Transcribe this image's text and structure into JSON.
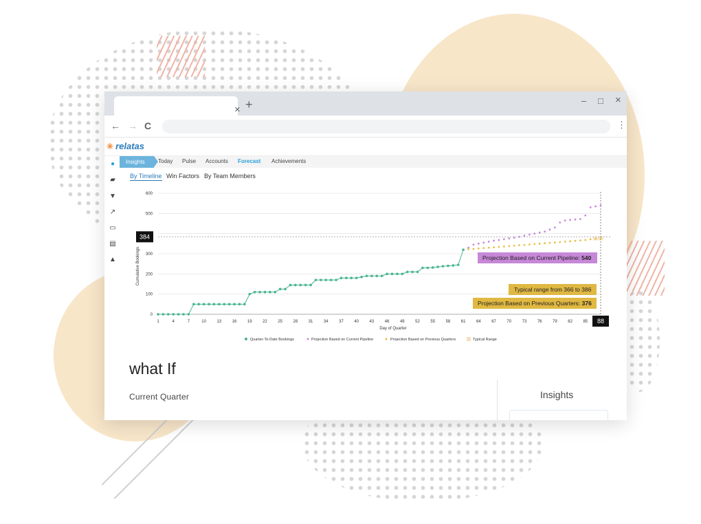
{
  "browser": {
    "tab_close": "×",
    "new_tab": "+",
    "minimize": "–",
    "maximize": "□",
    "close": "×",
    "back": "←",
    "forward": "→",
    "reload": "C",
    "menu": "⋮"
  },
  "app": {
    "logo_text": "relatas",
    "sidebar_icons": [
      "lightbulb-icon",
      "chat-icon",
      "funnel-icon",
      "trend-icon",
      "card-icon",
      "document-icon",
      "bell-icon"
    ],
    "nav": {
      "items": [
        "Insights",
        "Today",
        "Pulse",
        "Accounts",
        "Forecast",
        "Achievements"
      ],
      "active": "Insights",
      "highlight": "Forecast"
    },
    "subtabs": {
      "items": [
        "By Timeline",
        "Win Factors",
        "By Team Members"
      ],
      "active": "By Timeline"
    },
    "colors": {
      "accent": "#6cb4dd",
      "bookings": "#48b58e",
      "pipeline": "#c788d8",
      "previous": "#e9bf45",
      "typical": "#f5e0c0"
    }
  },
  "chart_data": {
    "type": "line",
    "xlabel": "Day of Quarter",
    "ylabel": "Cumulative Bookings",
    "xlim": [
      1,
      88
    ],
    "ylim": [
      0,
      600
    ],
    "x_ticks": [
      1,
      4,
      7,
      10,
      13,
      16,
      19,
      22,
      25,
      28,
      31,
      34,
      37,
      40,
      43,
      46,
      49,
      52,
      55,
      58,
      61,
      64,
      67,
      70,
      73,
      76,
      79,
      82,
      85
    ],
    "y_ticks": [
      0,
      100,
      200,
      300,
      400,
      500,
      600
    ],
    "cursor": {
      "x": 88,
      "y": 384,
      "x_label": "88",
      "y_label": "384"
    },
    "series": [
      {
        "name": "Quarter-To-Date Bookings",
        "style": "line-dots",
        "x": [
          1,
          2,
          3,
          4,
          5,
          6,
          7,
          8,
          9,
          10,
          11,
          12,
          13,
          14,
          15,
          16,
          17,
          18,
          19,
          20,
          21,
          22,
          23,
          24,
          25,
          26,
          27,
          28,
          29,
          30,
          31,
          32,
          33,
          34,
          35,
          36,
          37,
          38,
          39,
          40,
          41,
          42,
          43,
          44,
          45,
          46,
          47,
          48,
          49,
          50,
          51,
          52,
          53,
          54,
          55,
          56,
          57,
          58,
          59,
          60,
          61
        ],
        "values": [
          0,
          0,
          0,
          0,
          0,
          0,
          0,
          50,
          50,
          50,
          50,
          50,
          50,
          50,
          50,
          50,
          50,
          50,
          100,
          110,
          110,
          110,
          110,
          110,
          125,
          125,
          145,
          145,
          145,
          145,
          145,
          170,
          170,
          170,
          170,
          170,
          180,
          180,
          180,
          180,
          185,
          190,
          190,
          190,
          190,
          200,
          200,
          200,
          200,
          210,
          210,
          210,
          230,
          230,
          232,
          235,
          238,
          240,
          242,
          245,
          320
        ]
      },
      {
        "name": "Projection Based on Current Pipeline",
        "style": "dots",
        "x": [
          62,
          63,
          64,
          65,
          66,
          67,
          68,
          69,
          70,
          71,
          72,
          73,
          74,
          75,
          76,
          77,
          78,
          79,
          80,
          81,
          82,
          83,
          84,
          85,
          86,
          87,
          88
        ],
        "values": [
          330,
          345,
          350,
          355,
          360,
          365,
          368,
          372,
          376,
          380,
          384,
          390,
          395,
          400,
          405,
          410,
          420,
          430,
          455,
          465,
          468,
          470,
          472,
          490,
          530,
          535,
          540
        ]
      },
      {
        "name": "Projection Based on Previous Quarters",
        "style": "dots",
        "x": [
          62,
          63,
          64,
          65,
          66,
          67,
          68,
          69,
          70,
          71,
          72,
          73,
          74,
          75,
          76,
          77,
          78,
          79,
          80,
          81,
          82,
          83,
          84,
          85,
          86,
          87,
          88
        ],
        "values": [
          322,
          324,
          326,
          328,
          330,
          332,
          334,
          336,
          338,
          340,
          342,
          344,
          346,
          348,
          350,
          352,
          354,
          356,
          358,
          360,
          362,
          364,
          366,
          368,
          372,
          374,
          376
        ]
      }
    ],
    "typical_range": [
      366,
      386
    ],
    "legend": {
      "placement": "bottom",
      "entries": [
        "Quarter-To-Date Bookings",
        "Projection Based on Current Pipeline",
        "Projection Based on Previous Quarters",
        "Typical Range"
      ]
    },
    "annotations": {
      "pipeline_prefix": "Projection Based on Current Pipeline: ",
      "pipeline_value": "540",
      "typical": "Typical range from 366 to 386",
      "previous_prefix": "Projection Based on Previous Quarters: ",
      "previous_value": "376"
    }
  },
  "content": {
    "whatif_title": "what If",
    "current_quarter": "Current Quarter",
    "insights_title": "Insights"
  }
}
